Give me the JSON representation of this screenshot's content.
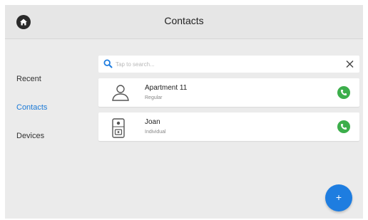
{
  "header": {
    "title": "Contacts"
  },
  "sidebar": {
    "items": [
      {
        "label": "Recent"
      },
      {
        "label": "Contacts",
        "active": true
      },
      {
        "label": "Devices"
      }
    ]
  },
  "search": {
    "placeholder": "Tap to search...",
    "value": ""
  },
  "contacts": [
    {
      "name": "Apartment 11",
      "type": "Regular",
      "icon": "person-icon"
    },
    {
      "name": "Joan",
      "type": "Individual",
      "icon": "door-station-icon"
    }
  ],
  "fab": {
    "label": "+"
  },
  "colors": {
    "accent": "#1e7de0",
    "call": "#3cae4b",
    "active_nav": "#1a79d6"
  }
}
